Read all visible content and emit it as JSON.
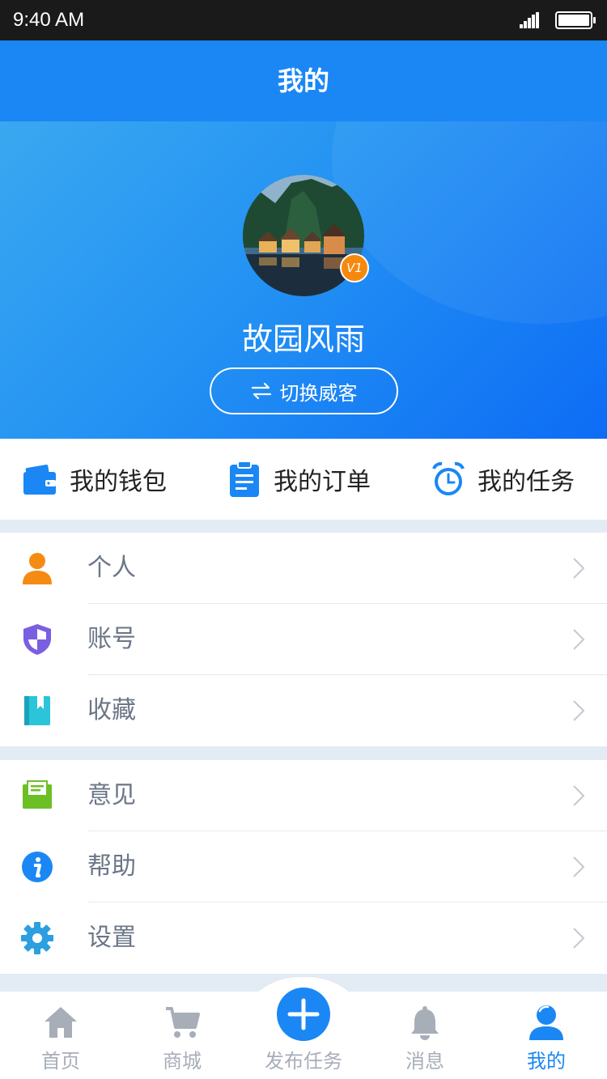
{
  "status": {
    "time": "9:40 AM"
  },
  "header": {
    "title": "我的"
  },
  "profile": {
    "name": "故园风雨",
    "level": "V1",
    "switch_label": "切换威客"
  },
  "quick_links": [
    {
      "label": "我的钱包",
      "icon": "wallet-icon"
    },
    {
      "label": "我的订单",
      "icon": "clipboard-icon"
    },
    {
      "label": "我的任务",
      "icon": "alarm-clock-icon"
    }
  ],
  "menu_group1": [
    {
      "label": "个人",
      "icon": "person-icon"
    },
    {
      "label": "账号",
      "icon": "shield-icon"
    },
    {
      "label": "收藏",
      "icon": "bookmark-icon"
    }
  ],
  "menu_group2": [
    {
      "label": "意见",
      "icon": "feedback-icon"
    },
    {
      "label": "帮助",
      "icon": "info-icon"
    },
    {
      "label": "设置",
      "icon": "gear-icon"
    }
  ],
  "tabs": [
    {
      "label": "首页",
      "icon": "home-icon"
    },
    {
      "label": "商城",
      "icon": "cart-icon"
    },
    {
      "label": "发布任务",
      "icon": "plus-icon"
    },
    {
      "label": "消息",
      "icon": "bell-icon"
    },
    {
      "label": "我的",
      "icon": "user-icon",
      "active": true
    }
  ],
  "colors": {
    "primary": "#1a87f5",
    "badge": "#f6890d",
    "muted": "#a7aeb8"
  }
}
